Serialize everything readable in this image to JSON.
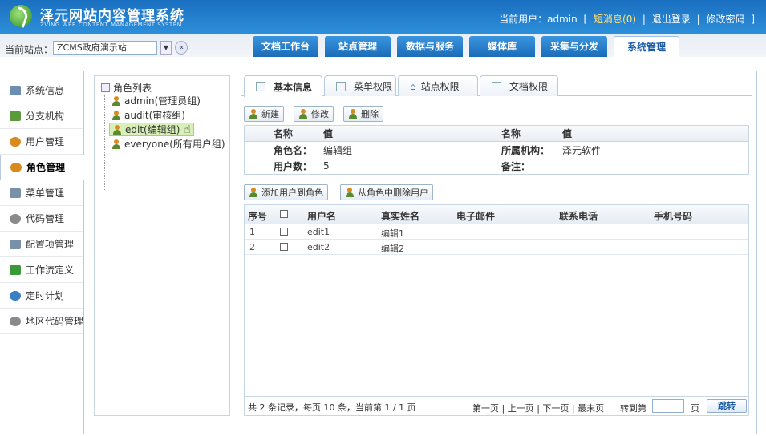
{
  "app": {
    "title": "泽元网站内容管理系统",
    "subtitle": "ZVING WEB CONTENT MANAGEMENT SYSTEM",
    "user_label": "当前用户：admin",
    "bracket_open": "[",
    "messages": "短消息(0)",
    "sep1": "|",
    "logout": "退出登录",
    "sep2": "|",
    "change_pwd": "修改密码",
    "bracket_close": "]"
  },
  "site": {
    "label": "当前站点：",
    "value": "ZCMS政府演示站",
    "arrow": "▼",
    "collapse": "«"
  },
  "nav": [
    "文档工作台",
    "站点管理",
    "数据与服务",
    "媒体库",
    "采集与分发",
    "系统管理"
  ],
  "sidebar": [
    {
      "label": "系统信息",
      "icon": "monitor-icon",
      "color": "#6b8fb3"
    },
    {
      "label": "分支机构",
      "icon": "org-tree-icon",
      "color": "#5b9a3a"
    },
    {
      "label": "用户管理",
      "icon": "user-icon",
      "color": "#d98a1e"
    },
    {
      "label": "角色管理",
      "icon": "role-icon",
      "color": "#d98a1e"
    },
    {
      "label": "菜单管理",
      "icon": "menu-icon",
      "color": "#7a8fa8"
    },
    {
      "label": "代码管理",
      "icon": "gear-icon",
      "color": "#8a8a8a"
    },
    {
      "label": "配置项管理",
      "icon": "config-icon",
      "color": "#7a8fa8"
    },
    {
      "label": "工作流定义",
      "icon": "workflow-icon",
      "color": "#3a9a3a"
    },
    {
      "label": "定时计划",
      "icon": "clock-icon",
      "color": "#3a7fc4"
    },
    {
      "label": "地区代码管理",
      "icon": "gear-icon",
      "color": "#8a8a8a"
    }
  ],
  "tree": {
    "root": "角色列表",
    "items": [
      "admin(管理员组)",
      "audit(审核组)",
      "edit(编辑组)",
      "everyone(所有用户组)"
    ]
  },
  "tabs": [
    "基本信息",
    "菜单权限",
    "站点权限",
    "文档权限"
  ],
  "actions": {
    "new": "新建",
    "edit": "修改",
    "delete": "删除"
  },
  "info": {
    "head_name": "名称",
    "head_value": "值",
    "head_name2": "名称",
    "head_value2": "值",
    "role_name_label": "角色名：",
    "role_name": "编辑组",
    "org_label": "所属机构：",
    "org": "泽元软件",
    "user_count_label": "用户数：",
    "user_count": "5",
    "remark_label": "备注：",
    "remark": ""
  },
  "user_actions": {
    "add": "添加用户到角色",
    "remove": "从角色中删除用户"
  },
  "grid": {
    "headers": [
      "序号",
      "用户名",
      "真实姓名",
      "电子邮件",
      "联系电话",
      "手机号码"
    ],
    "rows": [
      {
        "no": "1",
        "username": "edit1",
        "realname": "编辑1"
      },
      {
        "no": "2",
        "username": "edit2",
        "realname": "编辑2"
      }
    ],
    "summary": "共 2 条记录，每页 10 条，当前第 1 / 1 页",
    "pager": "第一页 | 上一页 | 下一页 | 最末页",
    "goto_label": "转到第",
    "page_unit": "页",
    "go": "跳转"
  }
}
